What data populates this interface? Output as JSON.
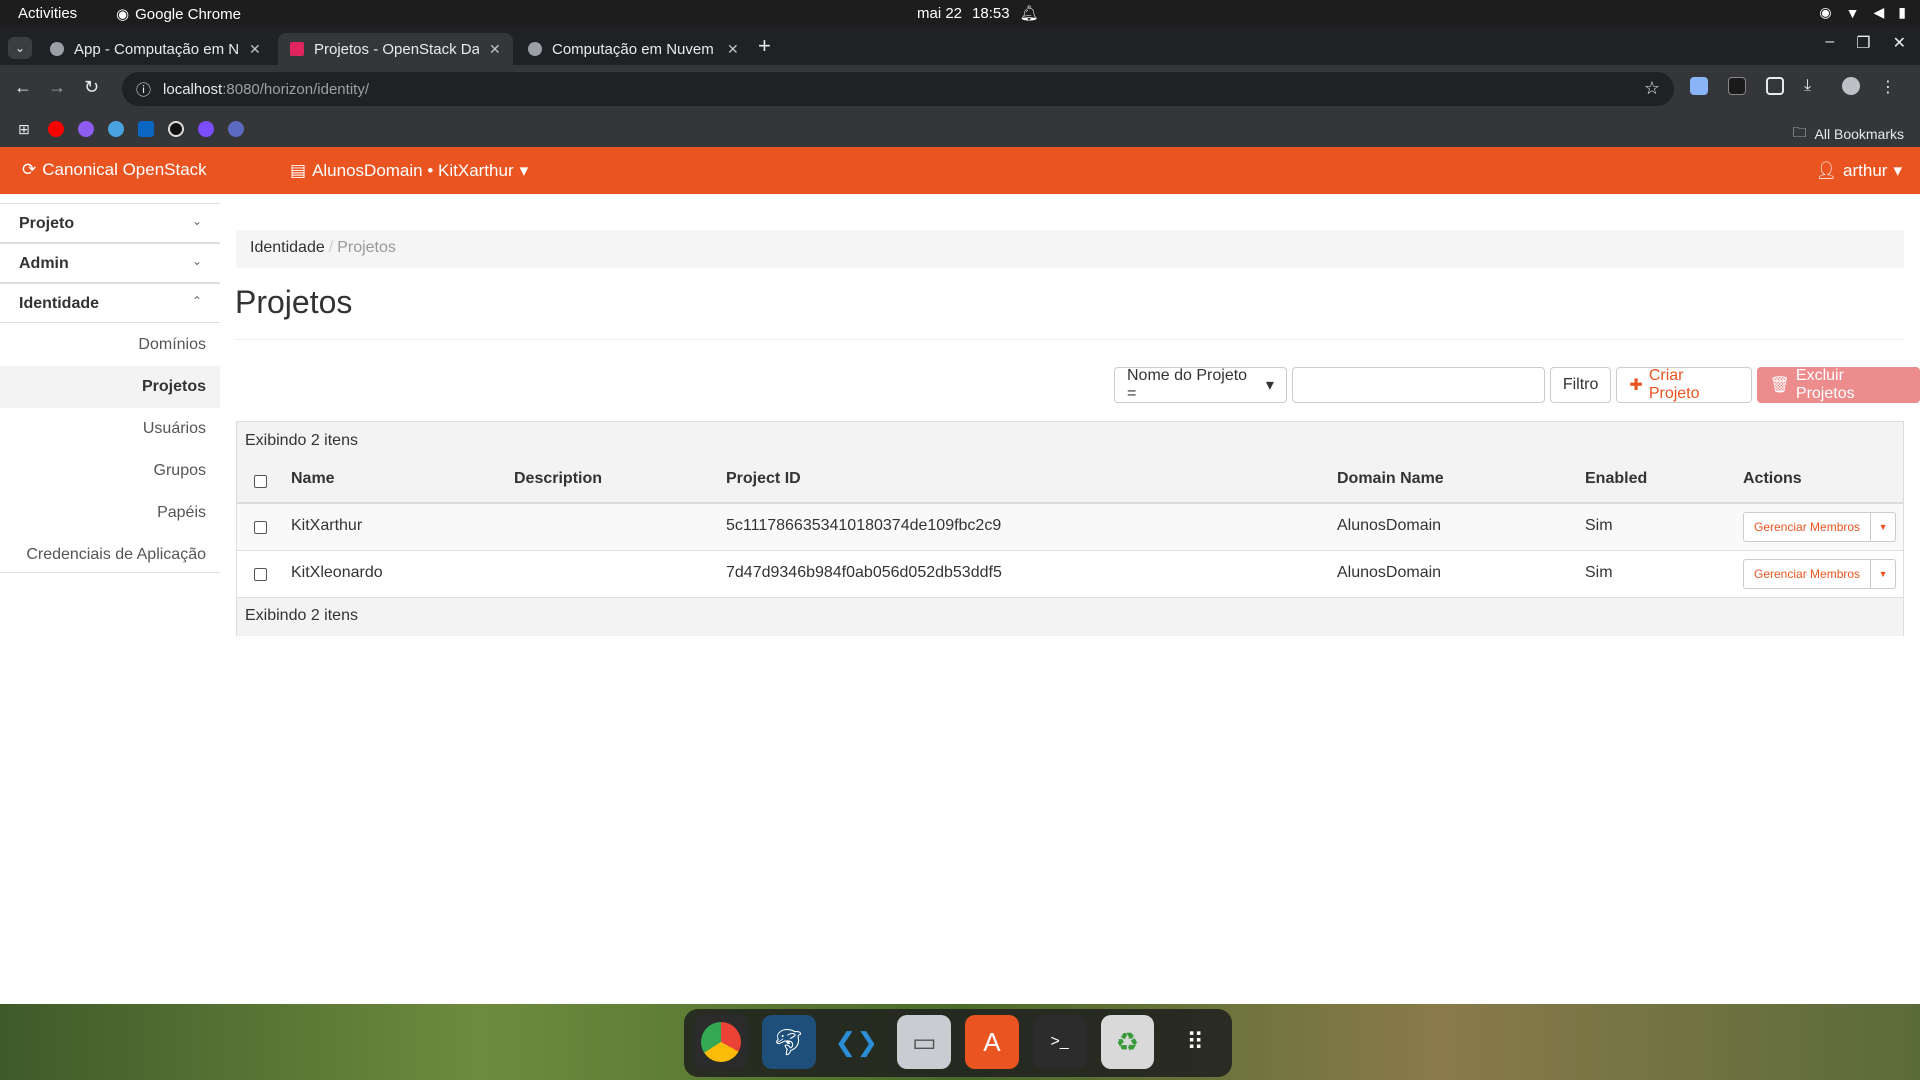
{
  "system": {
    "activities": "Activities",
    "app_name": "Google Chrome",
    "date": "mai 22",
    "time": "18:53"
  },
  "tabs": [
    {
      "title": "App - Computação em N",
      "active": false
    },
    {
      "title": "Projetos - OpenStack Da",
      "active": true
    },
    {
      "title": "Computação em Nuvem",
      "active": false
    }
  ],
  "address_bar": {
    "host": "localhost",
    "path": ":8080/horizon/identity/"
  },
  "bookmarks": {
    "all_label": "All Bookmarks"
  },
  "header": {
    "brand": "Canonical OpenStack",
    "context": "AlunosDomain • KitXarthur",
    "user": "arthur"
  },
  "sidebar": {
    "panels": [
      "Projeto",
      "Admin",
      "Identidade"
    ],
    "links": [
      "Domínios",
      "Projetos",
      "Usuários",
      "Grupos",
      "Papéis",
      "Credenciais de Aplicação"
    ],
    "active_link": "Projetos"
  },
  "breadcrumb": {
    "root": "Identidade",
    "current": "Projetos"
  },
  "page": {
    "title": "Projetos"
  },
  "filter": {
    "select_label": "Nome do Projeto =",
    "input_value": "",
    "filter_button": "Filtro",
    "create_button": "Criar Projeto",
    "delete_button": "Excluir Projetos"
  },
  "table": {
    "count_label": "Exibindo 2 itens",
    "columns": [
      "Name",
      "Description",
      "Project ID",
      "Domain Name",
      "Enabled",
      "Actions"
    ],
    "rows": [
      {
        "name": "KitXarthur",
        "description": "",
        "project_id": "5c1117866353410180374de109fbc2c9",
        "domain": "AlunosDomain",
        "enabled": "Sim",
        "action": "Gerenciar Membros"
      },
      {
        "name": "KitXleonardo",
        "description": "",
        "project_id": "7d47d9346b984f0ab056d052db53ddf5",
        "domain": "AlunosDomain",
        "enabled": "Sim",
        "action": "Gerenciar Membros"
      }
    ]
  },
  "dock": {
    "apps": [
      "chrome-icon",
      "mysql-workbench-icon",
      "vscode-icon",
      "files-icon",
      "app-center-icon",
      "terminal-icon",
      "trash-icon",
      "app-grid-icon"
    ]
  }
}
